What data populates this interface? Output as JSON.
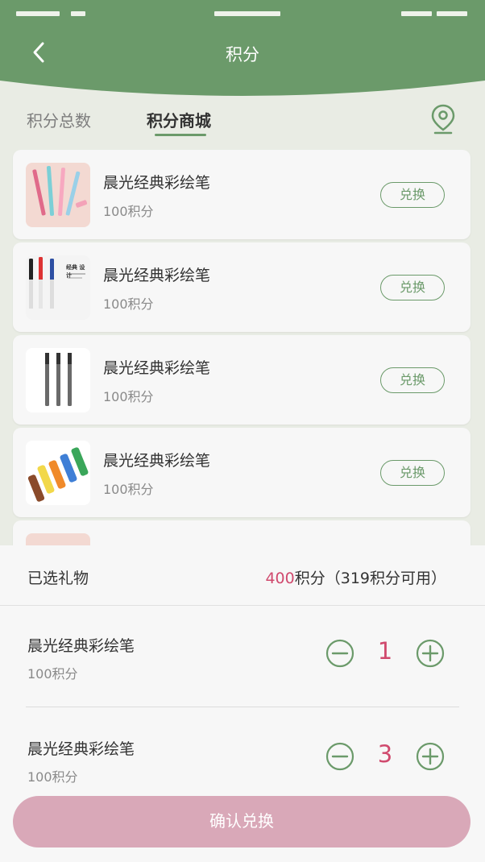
{
  "header": {
    "title": "积分",
    "back_icon": "chevron-left-icon",
    "bg_color": "#6b9a6a"
  },
  "tabs": [
    {
      "label": "积分总数"
    },
    {
      "label": "积分商城",
      "active": true
    }
  ],
  "location_icon": "location-pin-icon",
  "products": [
    {
      "name": "晨光经典彩绘笔",
      "points": "100积分",
      "action": "兑换"
    },
    {
      "name": "晨光经典彩绘笔",
      "points": "100积分",
      "action": "兑换"
    },
    {
      "name": "晨光经典彩绘笔",
      "points": "100积分",
      "action": "兑换"
    },
    {
      "name": "晨光经典彩绘笔",
      "points": "100积分",
      "action": "兑换"
    }
  ],
  "thumb_caption": "经典 设计",
  "sheet": {
    "title": "已选礼物",
    "total": "400",
    "total_suffix": "积分（319积分可用）",
    "items": [
      {
        "name": "晨光经典彩绘笔",
        "points": "100积分",
        "qty": "1"
      },
      {
        "name": "晨光经典彩绘笔",
        "points": "100积分",
        "qty": "3"
      }
    ],
    "confirm_label": "确认兑换"
  },
  "colors": {
    "accent": "#6b9a6a",
    "highlight": "#d04a6e",
    "confirm_bg": "#d9a8b8"
  }
}
